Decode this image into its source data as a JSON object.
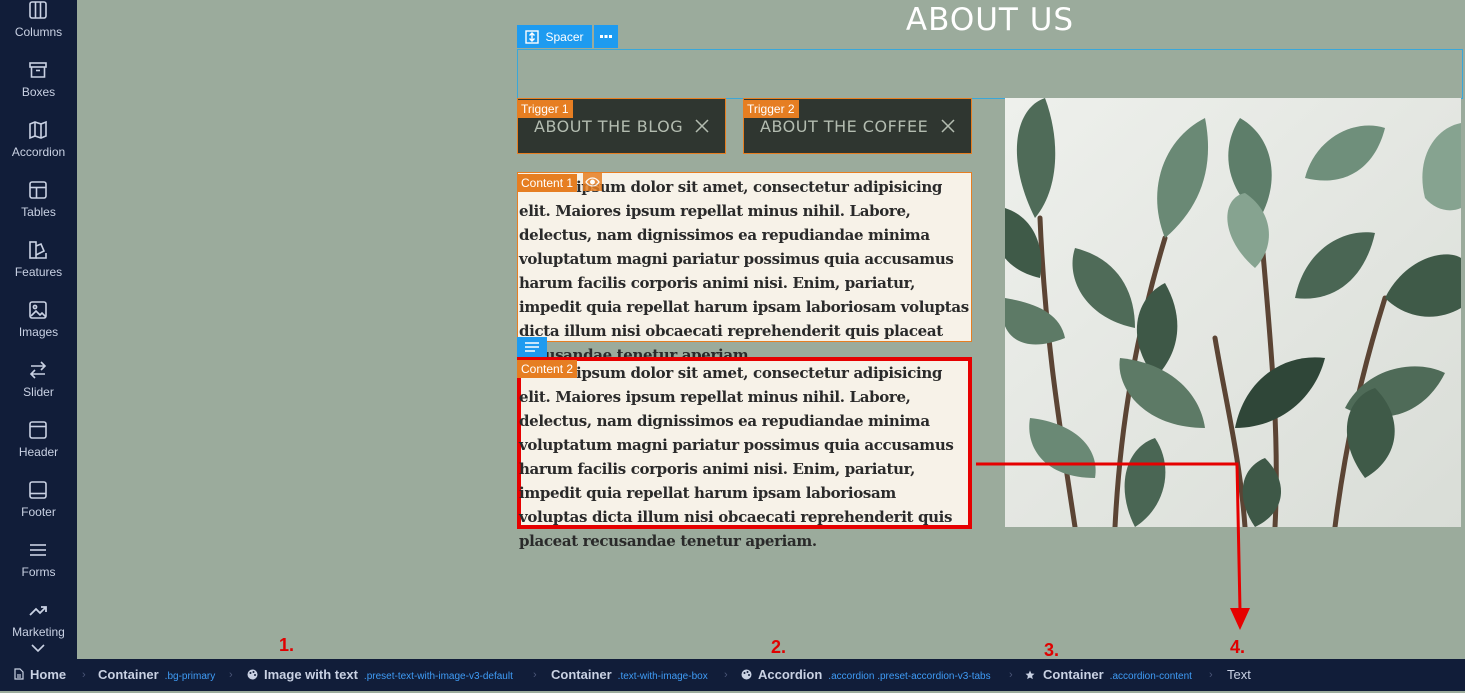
{
  "sidebar": {
    "items": [
      {
        "label": "Columns",
        "icon": "columns-icon"
      },
      {
        "label": "Boxes",
        "icon": "archive-box-icon"
      },
      {
        "label": "Accordion",
        "icon": "map-fold-icon"
      },
      {
        "label": "Tables",
        "icon": "table-icon"
      },
      {
        "label": "Features",
        "icon": "features-icon"
      },
      {
        "label": "Images",
        "icon": "image-icon"
      },
      {
        "label": "Slider",
        "icon": "arrows-swap-icon"
      },
      {
        "label": "Header",
        "icon": "header-icon"
      },
      {
        "label": "Footer",
        "icon": "footer-icon"
      },
      {
        "label": "Forms",
        "icon": "list-lines-icon"
      },
      {
        "label": "Marketing",
        "icon": "trending-up-icon"
      }
    ]
  },
  "canvas": {
    "title": "ABOUT US",
    "spacer_label": "Spacer",
    "trigger1_tag": "Trigger 1",
    "trigger1_text": "ABOUT THE BLOG",
    "trigger2_tag": "Trigger 2",
    "trigger2_text": "ABOUT THE COFFEE",
    "content1_tag": "Content 1",
    "content2_tag": "Content 2",
    "content1_text": "Lorem ipsum dolor sit amet, consectetur adipisicing elit. Maiores ipsum repellat minus nihil. Labore, delectus, nam dignissimos ea repudiandae minima voluptatum magni pariatur possimus quia accusamus harum facilis corporis animi nisi. Enim, pariatur, impedit quia repellat harum ipsam laboriosam voluptas dicta illum nisi obcaecati reprehenderit quis placeat recusandae tenetur aperiam.",
    "content2_text": "Lorem ipsum dolor sit amet, consectetur adipisicing elit. Maiores ipsum repellat minus nihil. Labore, delectus, nam dignissimos ea repudiandae minima voluptatum magni pariatur possimus quia accusamus harum facilis corporis animi nisi. Enim, pariatur, impedit quia repellat harum ipsam laboriosam voluptas dicta illum nisi obcaecati reprehenderit quis placeat recusandae tenetur aperiam."
  },
  "annotations": [
    "1.",
    "2.",
    "3.",
    "4."
  ],
  "breadcrumb": [
    {
      "label": "Home",
      "cls": ""
    },
    {
      "label": "Container",
      "cls": ".bg-primary"
    },
    {
      "label": "Image with text",
      "cls": ".preset-text-with-image-v3-default"
    },
    {
      "label": "Container",
      "cls": ".text-with-image-box"
    },
    {
      "label": "Accordion",
      "cls": ".accordion .preset-accordion-v3-tabs"
    },
    {
      "label": "Container",
      "cls": ".accordion-content"
    },
    {
      "label": "Text",
      "cls": ""
    }
  ],
  "colors": {
    "sidebar_bg": "#111d39",
    "canvas_bg": "#9bab9c",
    "accent_blue": "#1e9bf0",
    "accent_orange": "#e67e22",
    "highlight_red": "#e60000"
  }
}
